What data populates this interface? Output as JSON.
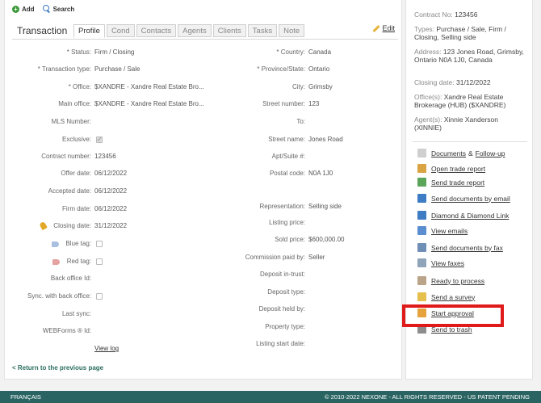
{
  "toolbar": {
    "add_label": "Add",
    "search_label": "Search"
  },
  "header": {
    "title": "Transaction",
    "tabs": [
      "Profile",
      "Cond",
      "Contacts",
      "Agents",
      "Clients",
      "Tasks",
      "Note"
    ],
    "active_tab": "Profile",
    "edit_label": "Edit"
  },
  "left_fields": [
    {
      "label": "* Status:",
      "value": "Firm / Closing"
    },
    {
      "label": "* Transaction type:",
      "value": "Purchase / Sale"
    },
    {
      "label": "* Office:",
      "value": "$XANDRE - Xandre Real Estate Bro..."
    },
    {
      "label": "Main office:",
      "value": "$XANDRE - Xandre Real Estate Bro..."
    },
    {
      "label": "MLS Number:",
      "value": ""
    },
    {
      "label": "Exclusive:",
      "value": "",
      "checkbox": "checked"
    },
    {
      "label": "Contract number:",
      "value": "123456"
    },
    {
      "label": "Offer date:",
      "value": "06/12/2022"
    },
    {
      "label": "Accepted date:",
      "value": "06/12/2022"
    },
    {
      "label": "Firm date:",
      "value": "06/12/2022"
    },
    {
      "label": "Closing date:",
      "value": "31/12/2022"
    },
    {
      "label": "Blue tag:",
      "value": "",
      "checkbox": "unchecked"
    },
    {
      "label": "Red tag:",
      "value": "",
      "checkbox": "unchecked"
    },
    {
      "label": "Back office Id:",
      "value": ""
    },
    {
      "label": "Sync. with back office:",
      "value": "",
      "checkbox": "unchecked"
    },
    {
      "label": "Last sync:",
      "value": ""
    },
    {
      "label": "WEBForms ® Id:",
      "value": ""
    }
  ],
  "view_log_label": "View log",
  "right_fields": [
    {
      "label": "* Country:",
      "value": "Canada"
    },
    {
      "label": "* Province/State:",
      "value": "Ontario"
    },
    {
      "label": "City:",
      "value": "Grimsby"
    },
    {
      "label": "Street number:",
      "value": "123"
    },
    {
      "label": "To:",
      "value": ""
    },
    {
      "label": "Street name:",
      "value": "Jones Road"
    },
    {
      "label": "Apt/Suite #:",
      "value": ""
    },
    {
      "label": "Postal code:",
      "value": "N0A 1J0"
    },
    {
      "label": "Representation:",
      "value": "Selling side"
    },
    {
      "label": "Listing price:",
      "value": ""
    },
    {
      "label": "Sold price:",
      "value": "$600,000.00"
    },
    {
      "label": "Commission paid by:",
      "value": "Seller"
    },
    {
      "label": "Deposit in-trust:",
      "value": ""
    },
    {
      "label": "Deposit type:",
      "value": ""
    },
    {
      "label": "Deposit held by:",
      "value": ""
    },
    {
      "label": "Property type:",
      "value": ""
    },
    {
      "label": "Listing start date:",
      "value": ""
    }
  ],
  "back_link": "< Return to the previous page",
  "side": {
    "contract_no_label": "Contract No:",
    "contract_no": "123456",
    "types_label": "Types:",
    "types": "Purchase / Sale, Firm / Closing, Selling side",
    "address_label": "Address:",
    "address": "123 Jones Road, Grimsby, Ontario N0A 1J0, Canada",
    "closing_label": "Closing date:",
    "closing": "31/12/2022",
    "office_label": "Office(s):",
    "office": "Xandre Real Estate Brokerage (HUB) ($XANDRE)",
    "agent_label": "Agent(s):",
    "agent": "Xinnie Xanderson (XINNIE)",
    "links": [
      {
        "label": "Documents",
        "icon": "document-icon"
      },
      {
        "label": "Open trade report",
        "icon": "report-icon"
      },
      {
        "label": "Send trade report",
        "icon": "send-report-icon"
      },
      {
        "label": "Send documents by email",
        "icon": "email-documents-icon"
      },
      {
        "label": "Diamond & Diamond Link",
        "icon": "building-icon"
      },
      {
        "label": "View emails",
        "icon": "email-icon"
      },
      {
        "label": "Send documents by fax",
        "icon": "fax-icon"
      },
      {
        "label": "View faxes",
        "icon": "fax-view-icon"
      },
      {
        "label": "Ready to process",
        "icon": "process-icon"
      },
      {
        "label": "Send a survey",
        "icon": "survey-icon"
      },
      {
        "label": "Start approval",
        "icon": "approval-icon"
      },
      {
        "label": "Send to trash",
        "icon": "trash-icon"
      }
    ],
    "documents_amp": "&",
    "followup_label": "Follow-up"
  },
  "footer": {
    "language": "FRANÇAIS",
    "copyright": "© 2010-2022 NEXONE - ALL RIGHTS RESERVED - US PATENT PENDING"
  },
  "colors": {
    "footer_bg": "#2a6462",
    "highlight": "#e01a1a",
    "add_green": "#3a9a3a"
  }
}
